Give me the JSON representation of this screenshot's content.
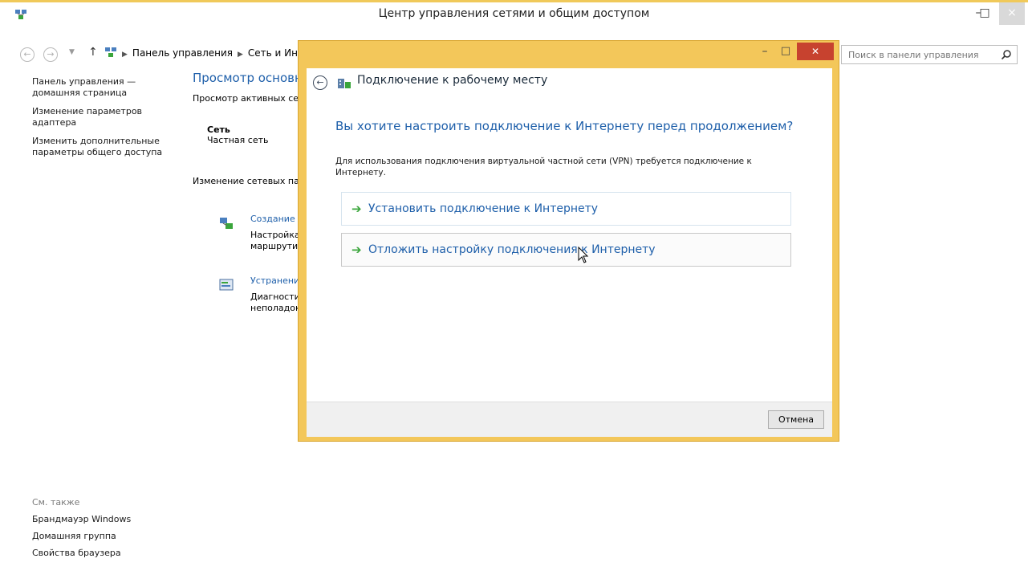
{
  "window": {
    "title": "Центр управления сетями и общим доступом",
    "minimize": "–",
    "maximize": "□",
    "close": "×"
  },
  "address": {
    "breadcrumbs": [
      "Панель управления",
      "Сеть и Интернет"
    ],
    "search_placeholder": "Поиск в панели управления"
  },
  "left_panel": {
    "links": [
      "Панель управления — домашняя страница",
      "Изменение параметров адаптера",
      "Изменить дополнительные параметры общего доступа"
    ],
    "see_also_title": "См. также",
    "see_also": [
      "Брандмауэр Windows",
      "Домашняя группа",
      "Свойства браузера"
    ]
  },
  "content": {
    "heading": "Просмотр основных сведений о сети и настройка подключений",
    "active_networks": "Просмотр активных сетей",
    "network_name": "Сеть",
    "network_type": "Частная сеть",
    "change_settings": "Изменение сетевых параметров",
    "tasks": [
      {
        "link": "Создание и настройка нового подключения или сети",
        "desc": [
          "Настройка",
          "маршрути"
        ]
      },
      {
        "link": "Устранение неполадок",
        "desc": [
          "Диагности",
          "неполадок"
        ]
      }
    ]
  },
  "dialog": {
    "title": "Подключение к рабочему месту",
    "minimize": "–",
    "maximize": "□",
    "close": "✕",
    "question": "Вы хотите настроить подключение к Интернету перед продолжением?",
    "description": "Для использования подключения виртуальной частной сети (VPN) требуется подключение к Интернету.",
    "options": [
      {
        "label": "Установить подключение к Интернету"
      },
      {
        "label": "Отложить настройку подключения к Интернету"
      }
    ],
    "cancel": "Отмена"
  },
  "colors": {
    "accent_border": "#f3c75a",
    "link_blue": "#1e5faa",
    "close_red": "#c7422f",
    "arrow_green": "#3aa53b"
  },
  "icons": {
    "app": "network-icon",
    "back": "back-arrow-icon",
    "forward": "forward-arrow-icon",
    "up": "up-arrow-icon",
    "search": "search-icon",
    "option": "green-arrow-icon"
  }
}
